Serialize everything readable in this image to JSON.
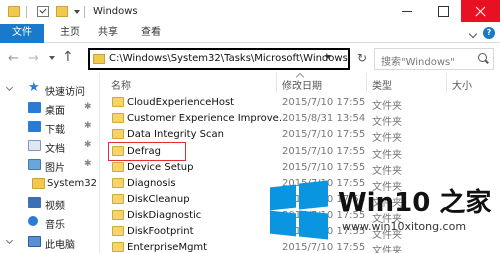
{
  "window": {
    "title": "Windows"
  },
  "ribbon": {
    "tabs": [
      "文件",
      "主页",
      "共享",
      "查看"
    ]
  },
  "nav": {
    "back": "←",
    "forward": "→",
    "up": "↑"
  },
  "address": {
    "path": "C:\\Windows\\System32\\Tasks\\Microsoft\\Windows"
  },
  "search": {
    "placeholder": "搜索\"Windows\""
  },
  "sidebar": {
    "items": [
      {
        "label": "快速访问",
        "icon": "star-icon"
      },
      {
        "label": "桌面",
        "icon": "desktop-icon",
        "pinned": true
      },
      {
        "label": "下载",
        "icon": "download-icon",
        "pinned": true
      },
      {
        "label": "文档",
        "icon": "document-icon",
        "pinned": true
      },
      {
        "label": "图片",
        "icon": "picture-icon",
        "pinned": true
      },
      {
        "label": "System32",
        "icon": "folder-icon"
      },
      {
        "label": "视频",
        "icon": "video-icon"
      },
      {
        "label": "音乐",
        "icon": "music-icon"
      },
      {
        "label": "此电脑",
        "icon": "computer-icon"
      }
    ]
  },
  "columns": {
    "name": "名称",
    "date": "修改日期",
    "type": "类型",
    "size": "大小"
  },
  "files": [
    {
      "name": "CloudExperienceHost",
      "date": "2015/7/10 17:55",
      "type": "文件夹"
    },
    {
      "name": "Customer Experience Improve...",
      "date": "2015/8/31 13:54",
      "type": "文件夹"
    },
    {
      "name": "Data Integrity Scan",
      "date": "2015/7/10 17:55",
      "type": "文件夹"
    },
    {
      "name": "Defrag",
      "date": "2015/7/10 17:55",
      "type": "文件夹"
    },
    {
      "name": "Device Setup",
      "date": "2015/7/10 17:55",
      "type": "文件夹"
    },
    {
      "name": "Diagnosis",
      "date": "2015/7/10 17:55",
      "type": "文件夹"
    },
    {
      "name": "DiskCleanup",
      "date": "2015/7/10 17:55",
      "type": "文件夹"
    },
    {
      "name": "DiskDiagnostic",
      "date": "2015/7/10 17:55",
      "type": "文件夹"
    },
    {
      "name": "DiskFootprint",
      "date": "2015/7/10 17:55",
      "type": "文件夹"
    },
    {
      "name": "EnterpriseMgmt",
      "date": "2015/7/10 17:55",
      "type": "文件夹"
    }
  ],
  "watermark": {
    "title": "Win10 之家",
    "url": "www.win10xitong.com"
  },
  "colors": {
    "accent": "#1979ca",
    "close": "#e81123",
    "highlight": "#e03030",
    "logo": "#0a95e0"
  }
}
